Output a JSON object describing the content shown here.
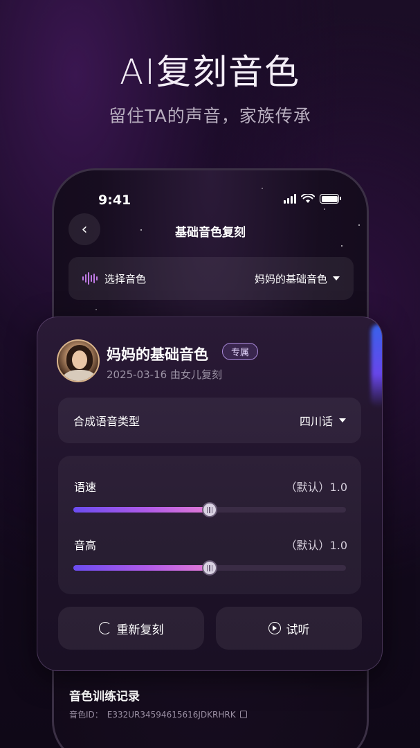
{
  "promo": {
    "headline": "AI复刻音色",
    "subline": "留住TA的声音，家族传承"
  },
  "status_bar": {
    "time": "9:41",
    "icons": [
      "signal-icon",
      "wifi-icon",
      "battery-icon"
    ]
  },
  "nav": {
    "back_icon": "chevron-left-icon",
    "title": "基础音色复刻"
  },
  "voice_selector": {
    "icon": "waveform-icon",
    "label": "选择音色",
    "value": "妈妈的基础音色"
  },
  "voice_card": {
    "name": "妈妈的基础音色",
    "badge": "专属",
    "meta": "2025-03-16 由女儿复刻",
    "synthesis_type": {
      "label": "合成语音类型",
      "value": "四川话"
    },
    "sliders": [
      {
        "label": "语速",
        "value_text": "（默认）1.0",
        "level": 0.5
      },
      {
        "label": "音高",
        "value_text": "（默认）1.0",
        "level": 0.5
      }
    ],
    "buttons": {
      "recopy": "重新复刻",
      "preview": "试听"
    }
  },
  "training_record": {
    "title": "音色训练记录",
    "id_label": "音色ID：",
    "id_value": "E332UR34594615616JDKRHRK"
  },
  "colors": {
    "accent_start": "#6b4cf0",
    "accent_end": "#e27ad5",
    "background": "#140a1e"
  }
}
